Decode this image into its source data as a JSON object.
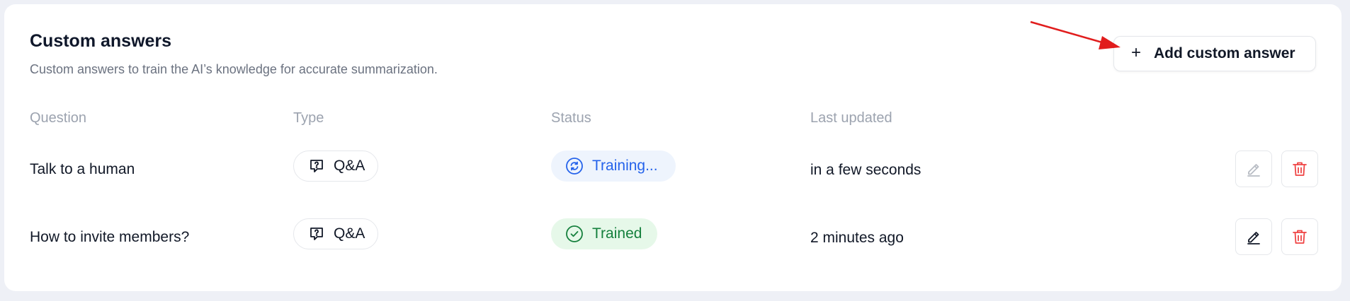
{
  "header": {
    "title": "Custom answers",
    "subtitle": "Custom answers to train the AI’s knowledge for accurate summarization.",
    "add_button_label": "Add custom answer",
    "add_button_icon": "plus-icon"
  },
  "table": {
    "columns": [
      "Question",
      "Type",
      "Status",
      "Last updated"
    ],
    "rows": [
      {
        "question": "Talk to a human",
        "type": "Q&A",
        "type_icon": "question-bubble-icon",
        "status": "Training...",
        "status_icon": "refresh-icon",
        "status_color": "#2563eb",
        "last_updated": "in a few seconds",
        "edit_enabled": false
      },
      {
        "question": "How to invite members?",
        "type": "Q&A",
        "type_icon": "question-bubble-icon",
        "status": "Trained",
        "status_icon": "check-circle-icon",
        "status_color": "#15803d",
        "last_updated": "2 minutes ago",
        "edit_enabled": true
      }
    ]
  },
  "colors": {
    "accent_red": "#ef4444",
    "annotation_arrow": "#e11d1d"
  }
}
